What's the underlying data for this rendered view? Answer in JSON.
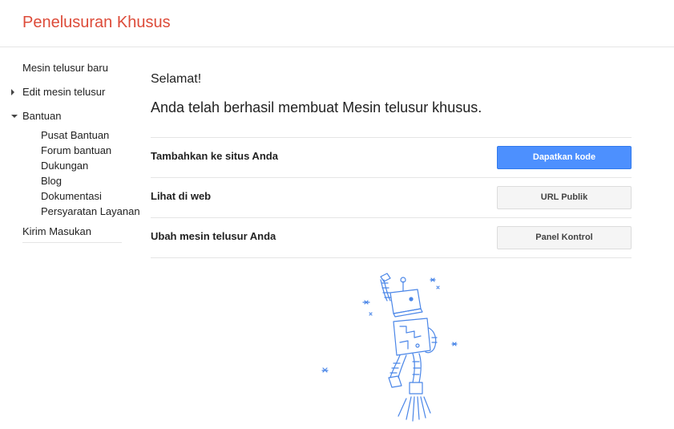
{
  "header": {
    "title": "Penelusuran Khusus"
  },
  "sidebar": {
    "new_engine": "Mesin telusur baru",
    "edit_engine": "Edit mesin telusur",
    "help": "Bantuan",
    "help_items": [
      "Pusat Bantuan",
      "Forum bantuan",
      "Dukungan",
      "Blog",
      "Dokumentasi",
      "Persyaratan Layanan"
    ],
    "feedback": "Kirim Masukan"
  },
  "main": {
    "greeting": "Selamat!",
    "success_message": "Anda telah berhasil membuat Mesin telusur khusus.",
    "rows": [
      {
        "label": "Tambahkan ke situs Anda",
        "button": "Dapatkan kode"
      },
      {
        "label": "Lihat di web",
        "button": "URL Publik"
      },
      {
        "label": "Ubah mesin telusur Anda",
        "button": "Panel Kontrol"
      }
    ]
  },
  "colors": {
    "brand": "#dd4b39",
    "primary_button": "#4d90fe",
    "illustration": "#4a86e8"
  },
  "icons": {
    "edit_toggle": "triangle-right-icon",
    "help_toggle": "triangle-down-icon",
    "illustration": "robot-illustration"
  }
}
